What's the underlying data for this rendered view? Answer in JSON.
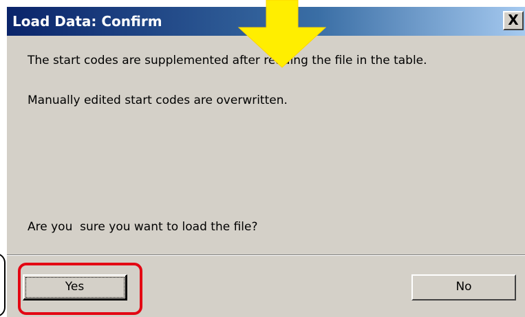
{
  "dialog": {
    "title": "Load Data: Confirm",
    "close_label": "X",
    "messages": {
      "line1": "The start codes are supplemented after reading the file in the table.",
      "line2": "Manually edited start codes are overwritten.",
      "question": "Are you  sure you want to load the file?"
    },
    "buttons": {
      "yes_label": "Yes",
      "no_label": "No"
    }
  },
  "annotations": {
    "arrow_color": "#ffee00",
    "highlight_color": "#e30613"
  },
  "colors": {
    "dialog_background": "#d4d0c8",
    "titlebar_start": "#0a246a",
    "titlebar_end": "#a6caf0"
  }
}
